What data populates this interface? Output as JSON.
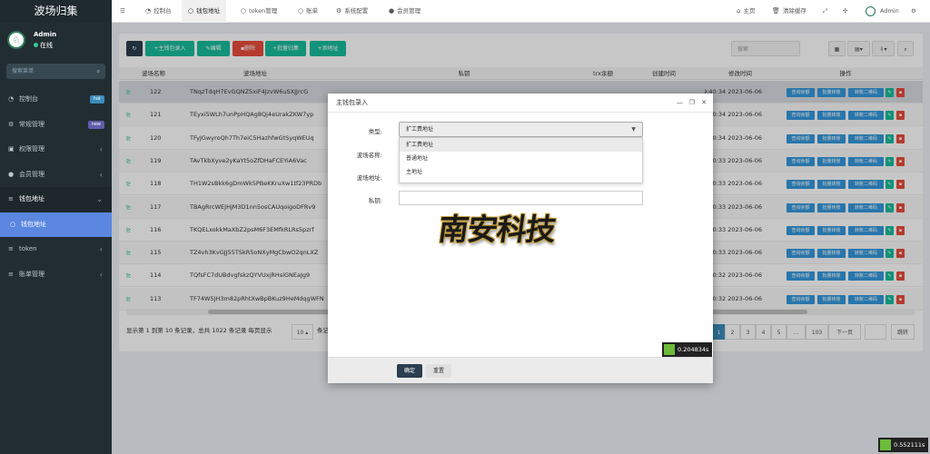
{
  "sidebar": {
    "title": "波场归集",
    "user_name": "Admin",
    "user_status": "在线",
    "search_placeholder": "搜索菜单",
    "items": [
      {
        "label": "控制台",
        "icon": "dashboard-icon",
        "badge": "hot",
        "badge_color": "#3c8dbc"
      },
      {
        "label": "常规管理",
        "icon": "cog-icon",
        "badge": "new",
        "badge_color": "#605ca8"
      },
      {
        "label": "权限管理",
        "icon": "group-icon"
      },
      {
        "label": "会员管理",
        "icon": "user-icon"
      },
      {
        "label": "钱包地址",
        "icon": "list-icon"
      },
      {
        "label": "钱包地址",
        "icon": "circle-icon"
      },
      {
        "label": "token",
        "icon": "list-icon"
      },
      {
        "label": "账单管理",
        "icon": "list-icon"
      }
    ]
  },
  "topnav": {
    "tabs": [
      {
        "label": "控制台",
        "icon": "dashboard-icon"
      },
      {
        "label": "钱包地址",
        "icon": "circle-icon"
      },
      {
        "label": "token管理",
        "icon": "circle-icon"
      },
      {
        "label": "账单",
        "icon": "circle-icon"
      },
      {
        "label": "系统配置",
        "icon": "cog-icon"
      },
      {
        "label": "会员管理",
        "icon": "user-icon"
      }
    ],
    "home": "主页",
    "clear_cache": "清除缓存",
    "admin": "Admin"
  },
  "toolbar": {
    "add_main": "+主钱包录入",
    "edit": "编辑",
    "delete": "删除",
    "batch_collect": "+批量归集",
    "dropdown_addr": "+添地址",
    "search_placeholder": "搜索"
  },
  "table": {
    "headers": [
      "波场名称",
      "波场地址",
      "私钥",
      "trx余额",
      "创建时间",
      "修改时间",
      "操作"
    ],
    "action_labels": [
      "查询余额",
      "批量转账",
      "转账二维码"
    ],
    "rows": [
      {
        "id": "122",
        "addr": "TNqzTdqH7EvGQNZ5xiF4JzvW6uSXJJrcG",
        "mtime": "2023-06-06 19:40:34"
      },
      {
        "id": "121",
        "addr": "TEyxi5WLh7unPpHQAg8Qj4eUrakZKW7yp",
        "mtime": "2023-06-06 19:40:34"
      },
      {
        "id": "120",
        "addr": "TFyJGwyroQh7Th7eiC5HazhfwGtSyqWEUq",
        "mtime": "2023-06-06 19:40:34"
      },
      {
        "id": "119",
        "addr": "TAvTkbXyve2yKaYt5oZfDHaFCEYiA6Vac",
        "mtime": "2023-06-06 19:40:33"
      },
      {
        "id": "118",
        "addr": "TH1W2sBkk6gDmWk5PBeKKruXw1tf23PRDb",
        "mtime": "2023-06-06 19:40:33"
      },
      {
        "id": "117",
        "addr": "TBAgRrcWEJHjM3D1nn5osCAUqoigoDFRv9",
        "mtime": "2023-06-06 19:40:33"
      },
      {
        "id": "116",
        "addr": "TKQELxokkMaXbZ2psM6F3EMfkRLRs5pzrf",
        "mtime": "2023-06-06 19:40:33"
      },
      {
        "id": "115",
        "addr": "TZ4vh3KvGJJ55TSkR5oNXyMgCbwO2qnLXZ",
        "mtime": "2023-06-06 19:40:33"
      },
      {
        "id": "114",
        "addr": "TQfsFC7dUBdvgfskzQYVUxjRHsiGNEaJg9",
        "mtime": "2023-06-06 19:40:32"
      },
      {
        "id": "113",
        "addr": "TF74W5JH3m82pRhtXwBpBKuz9HeMdqgWFN",
        "mtime": "2023-06-06 19:40:32"
      }
    ]
  },
  "pagination": {
    "summary": "显示第 1 到第 10 条记录，总共 1022 条记录 每页显示",
    "per_page": "10",
    "per_page_suffix": "条记录",
    "pages": [
      "2",
      "3",
      "4",
      "5",
      "...",
      "103"
    ],
    "next": "下一页",
    "jump": "跳转"
  },
  "modal": {
    "title": "主钱包录入",
    "type_label": "类型:",
    "type_value": "扩工费地址",
    "options": [
      "扩工费地址",
      "普通地址",
      "主地址"
    ],
    "name_label": "波场名称:",
    "addr_label": "波场地址:",
    "key_label": "私钥:",
    "ok": "确定",
    "reset": "重置"
  },
  "brand_overlay": "南安科技",
  "timers": [
    "0.204834s",
    "0.552111s"
  ]
}
